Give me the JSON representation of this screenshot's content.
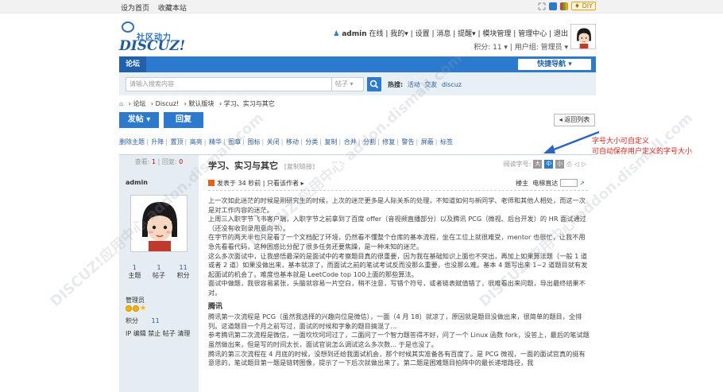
{
  "topbar": {
    "set_home": "设为首页",
    "bookmark": "收藏本站",
    "diy": "DIY"
  },
  "logo": {
    "cn": "社区动力",
    "en": "DISCUZ!"
  },
  "user": {
    "name": "admin",
    "status": "在线",
    "links": [
      "我的",
      "设置",
      "消息",
      "提醒",
      "模块管理",
      "管理中心",
      "退出"
    ],
    "points": "积分: 11",
    "group": "用户组: 管理员"
  },
  "nav": {
    "forum": "论坛",
    "quick_nav": "快捷导航"
  },
  "search": {
    "placeholder": "请输入搜索内容",
    "type": "帖子",
    "hot_label": "热搜:",
    "hot_words": [
      "活动",
      "交友",
      "discuz"
    ]
  },
  "breadcrumb": [
    "论坛",
    "Discuz!",
    "默认版块",
    "学习、实习与其它"
  ],
  "actions": {
    "post": "发帖",
    "reply": "回复",
    "back": "返回列表"
  },
  "mod_tools": [
    "删除主题",
    "升降",
    "置顶",
    "高亮",
    "精华",
    "图章",
    "图标",
    "关闭",
    "移动",
    "分类",
    "复制",
    "合并",
    "分割",
    "修复",
    "警告",
    "屏蔽",
    "标签"
  ],
  "thread": {
    "views_label": "查看:",
    "views": "1",
    "replies_label": "回复:",
    "replies": "0",
    "title": "学习、实习与其它",
    "copy_link": "[复制链接]",
    "font_label": "阅读字号:",
    "font_sizes": [
      "大",
      "中",
      "小"
    ],
    "posted": "发表于 34 秒前",
    "author_only": "只看该作者",
    "floor": "楼主",
    "jump_label": "电梯直达"
  },
  "author": {
    "name": "admin",
    "stats": [
      {
        "value": "1",
        "label": "主题"
      },
      {
        "value": "1",
        "label": "帖子"
      },
      {
        "value": "11",
        "label": "积分"
      }
    ],
    "group": "管理员",
    "points_label": "积分",
    "points": "11",
    "actions": "IP 编辑 禁止 帖子 清理"
  },
  "post_body": {
    "paragraphs": [
      "上一次如此迷茫的时候是刚研究生的时候，上次的迷茫更多是人际关系的处理，不知道如何与新同学、老师和其他人相处，而这一次是对工作内容的迷茫。",
      "上周三入职字节飞书客户端，入职字节之前拿到了百度 offer（音视频直播部分）以及腾讯 PCG（微视、后台开发）的 HR 面试通过（还没有收到录用意向书）。",
      "在字节的两天半也只是看了一个文档配了环境，仍然看不懂整个仓库的基本流程，坐在工位上就很难受，mentor 也很忙，让我不用急先看看代码，这种困惑比分配了很多任务还要焦躁，是一种未知的迷茫。",
      "这么多次面试中，让我感悟最深的是面试中的考察题目真的很重要，因为我在基础知识上面也不突出，再加上如果算法题（一般 1 道或者 2 道）如果没做出来，基本就凉了，而面试之前的笔试考试反而没那么重要，也没那么难。基本 4 题写出来 1~2 道题目就有发起面试的机会了。难度也基本就是 LeetCode top 100上面的那些算法。",
      "面试中做题，我很容易紧张，头脑就容易一片空白，稍不注意，写错个符号，或者链表赋值错了，很难看出来问题，导出最终结果不对。"
    ],
    "section": "腾讯",
    "section_paragraphs": [
      "腾讯第一次流程是 PCG（虽然我选择的兴趣向位是微信），一面（4 月 18）就凉了，原因就是题目没做出来，很简单的题目，全排列。这道题目一个月之前写过，面试的时候和字象的题目搞混了...",
      "参考腾讯第二次流程是微信，一面坎坎坷坷过了，二面问了一个智力题答得不好，问了一个 Linux 函数 fork，没答上，最后的笔试题虽然做出来，但是写的时间太长，面试官说怎么调试这么多次数... 于是也没了。",
      "腾讯的第三次流程在 4 月底的时候，没想到还给我面试机会，那个时候其实准备各有百度了。是 PCG 微视，一面的面试官真的挺有意思的，笔试题目第一题是链转图像，提示了一下后次就做出来了。第二题是困难题目拍阵中的最长递增路径，我"
    ]
  },
  "watermark": "DISCUZ!应用中心 addon.dismall.com",
  "annotation": [
    "字号大小可自定义",
    "可自动保存用户定义的字号大小"
  ]
}
